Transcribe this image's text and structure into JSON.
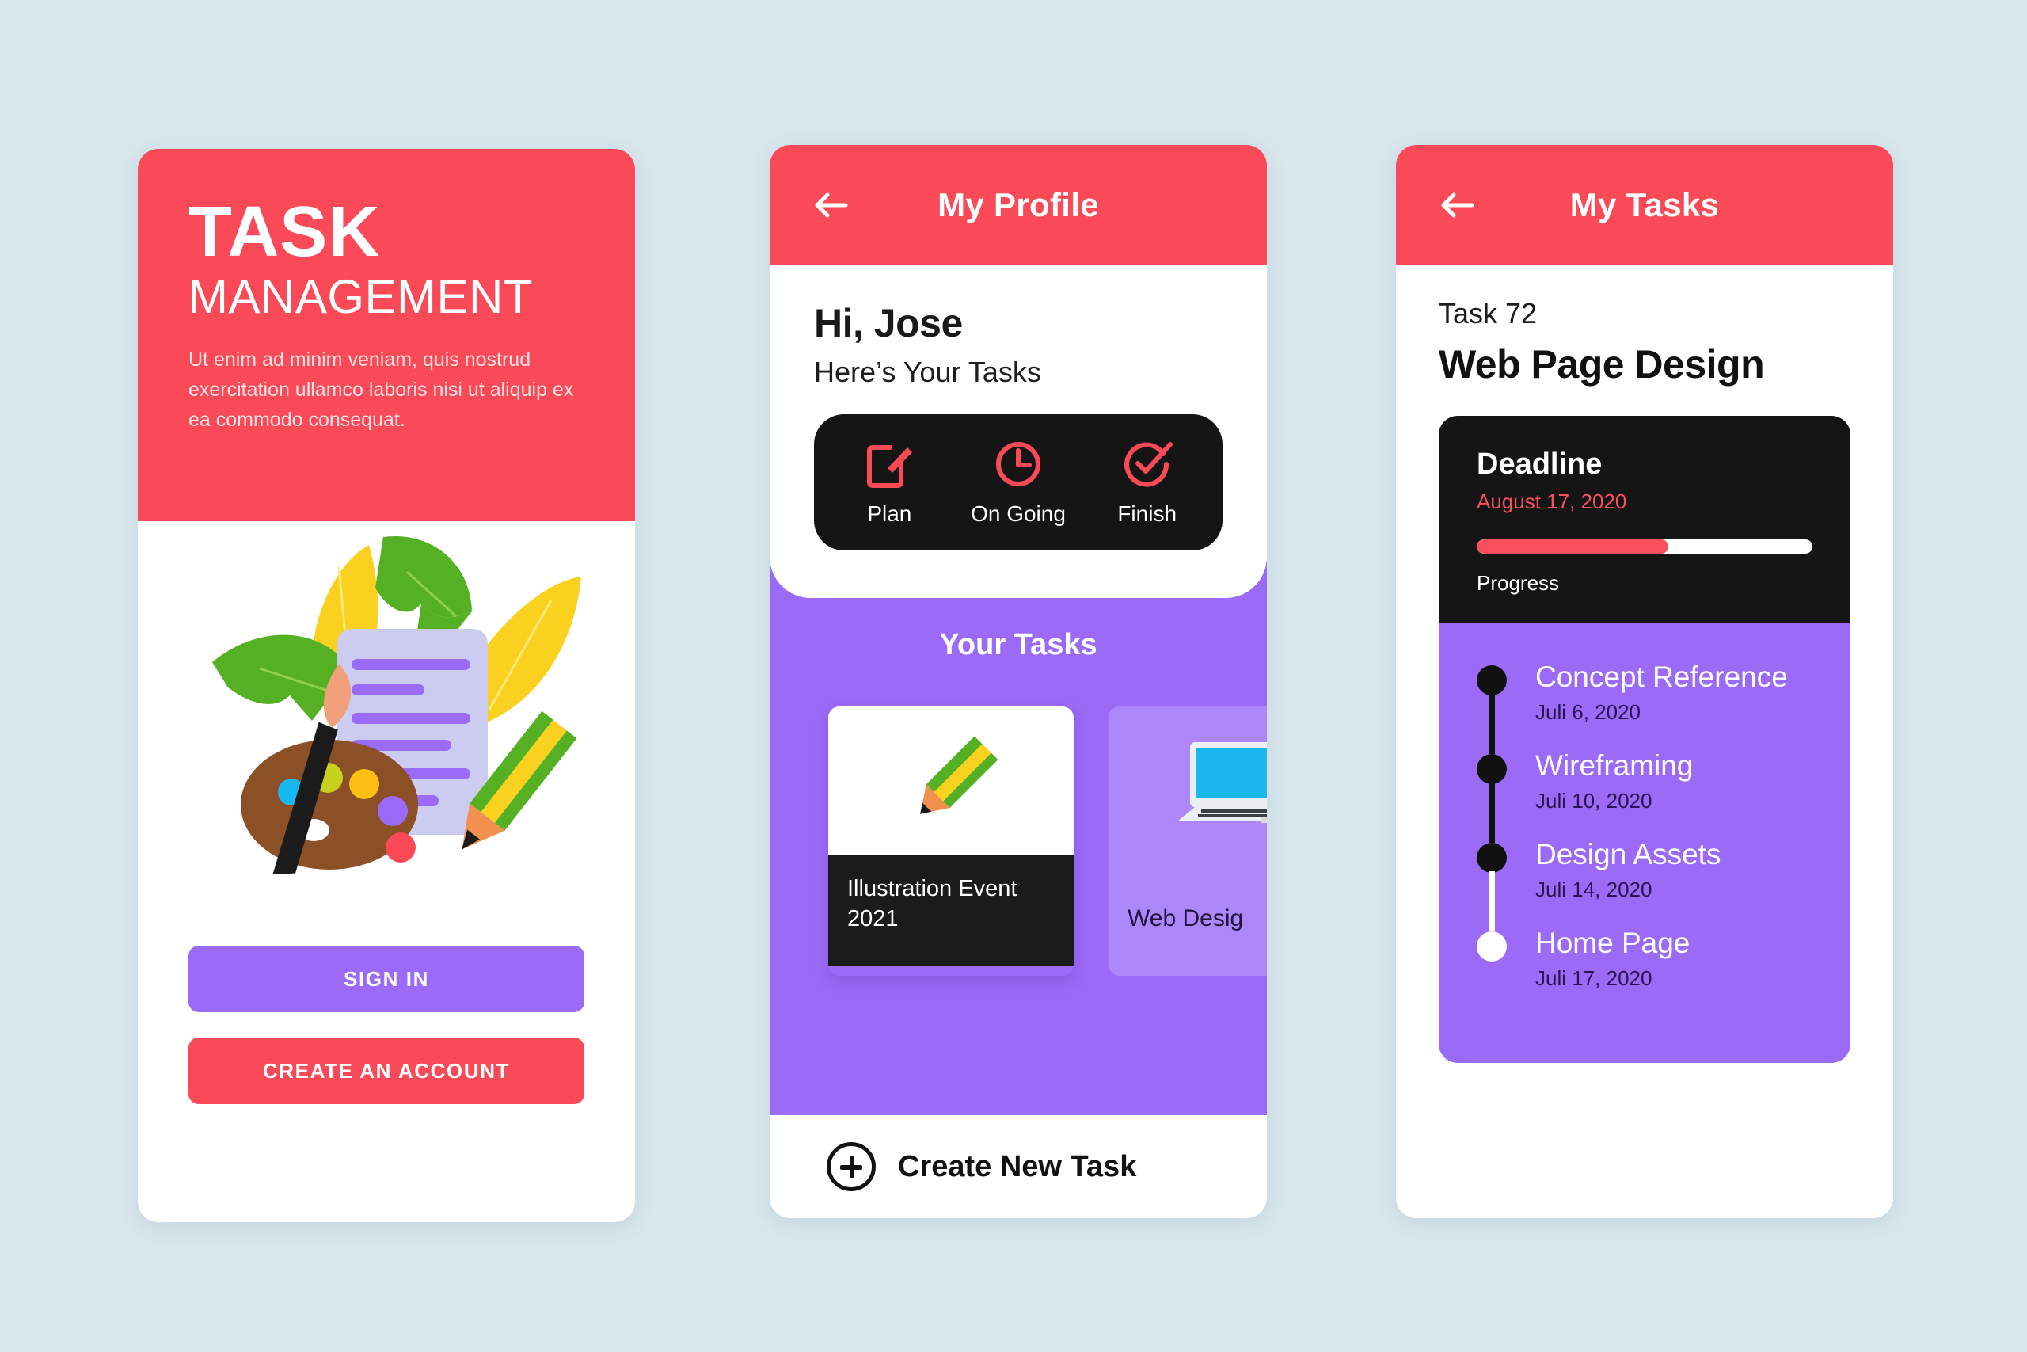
{
  "colors": {
    "background": "#d8e6ed",
    "brand_red": "#fa4a58",
    "brand_purple": "#9b6bf7",
    "dark": "#151515",
    "white": "#ffffff"
  },
  "screen1": {
    "title": "TASK",
    "subtitle": "MANAGEMENT",
    "body": "Ut enim ad minim veniam, quis nostrud exercitation ullamco laboris nisi ut aliquip ex ea commodo consequat.",
    "illustration_name": "creative-tools-illustration",
    "sign_in_label": "SIGN IN",
    "create_account_label": "CREATE AN ACCOUNT"
  },
  "screen2": {
    "appbar": {
      "back_icon": "arrow-left-icon",
      "title": "My Profile"
    },
    "greeting": "Hi, Jose",
    "greeting_sub": "Here’s Your Tasks",
    "tabs": [
      {
        "label": "Plan",
        "icon": "edit-square-icon"
      },
      {
        "label": "On Going",
        "icon": "clock-icon"
      },
      {
        "label": "Finish",
        "icon": "check-circle-icon"
      }
    ],
    "section_title": "Your Tasks",
    "cards": [
      {
        "title": "Illustration Event 2021",
        "icon": "pencil-icon"
      },
      {
        "title": "Web Desig",
        "icon": "laptop-icon"
      }
    ],
    "create_task_label": "Create New Task",
    "create_task_icon": "plus-circle-icon"
  },
  "screen3": {
    "appbar": {
      "back_icon": "arrow-left-icon",
      "title": "My Tasks"
    },
    "task_number": "Task 72",
    "task_title": "Web Page Design",
    "deadline_label": "Deadline",
    "deadline_date": "August 17, 2020",
    "progress_percent": 57,
    "progress_label": "Progress",
    "timeline": [
      {
        "name": "Concept Reference",
        "date": "Juli 6, 2020",
        "state": "done"
      },
      {
        "name": "Wireframing",
        "date": "Juli 10, 2020",
        "state": "done"
      },
      {
        "name": "Design Assets",
        "date": "Juli 14, 2020",
        "state": "done"
      },
      {
        "name": "Home Page",
        "date": "Juli 17, 2020",
        "state": "current"
      }
    ]
  }
}
